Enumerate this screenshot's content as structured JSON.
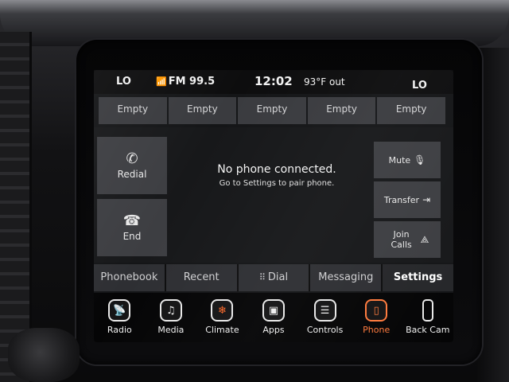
{
  "status_bar": {
    "left_zone": "LO",
    "radio_icon": "antenna-icon",
    "radio_station": "FM 99.5",
    "clock": "12:02",
    "outside_temp": "93°F out",
    "right_zone": "LO"
  },
  "presets": [
    "Empty",
    "Empty",
    "Empty",
    "Empty",
    "Empty"
  ],
  "phone": {
    "redial_label": "Redial",
    "end_label": "End",
    "message_title": "No phone connected.",
    "message_sub": "Go to Settings to pair phone.",
    "mute_label": "Mute",
    "transfer_label": "Transfer",
    "join_label": "Join Calls"
  },
  "tabs": [
    {
      "label": "Phonebook",
      "active": false
    },
    {
      "label": "Recent",
      "active": false
    },
    {
      "label": "Dial",
      "active": false
    },
    {
      "label": "Messaging",
      "active": false
    },
    {
      "label": "Settings",
      "active": true
    }
  ],
  "nav": [
    {
      "label": "Radio",
      "icon": "radio-icon"
    },
    {
      "label": "Media",
      "icon": "music-note-icon"
    },
    {
      "label": "Climate",
      "icon": "climate-icon"
    },
    {
      "label": "Apps",
      "icon": "apps-icon"
    },
    {
      "label": "Controls",
      "icon": "controls-icon"
    },
    {
      "label": "Phone",
      "icon": "phone-icon",
      "active": true
    },
    {
      "label": "Back Cam",
      "icon": "back-cam-icon"
    }
  ],
  "colors": {
    "accent": "#ff7a3d",
    "button_bg": "#3d3e42",
    "preset_bg": "#3a3b3f",
    "screen_bg": "#141517"
  }
}
